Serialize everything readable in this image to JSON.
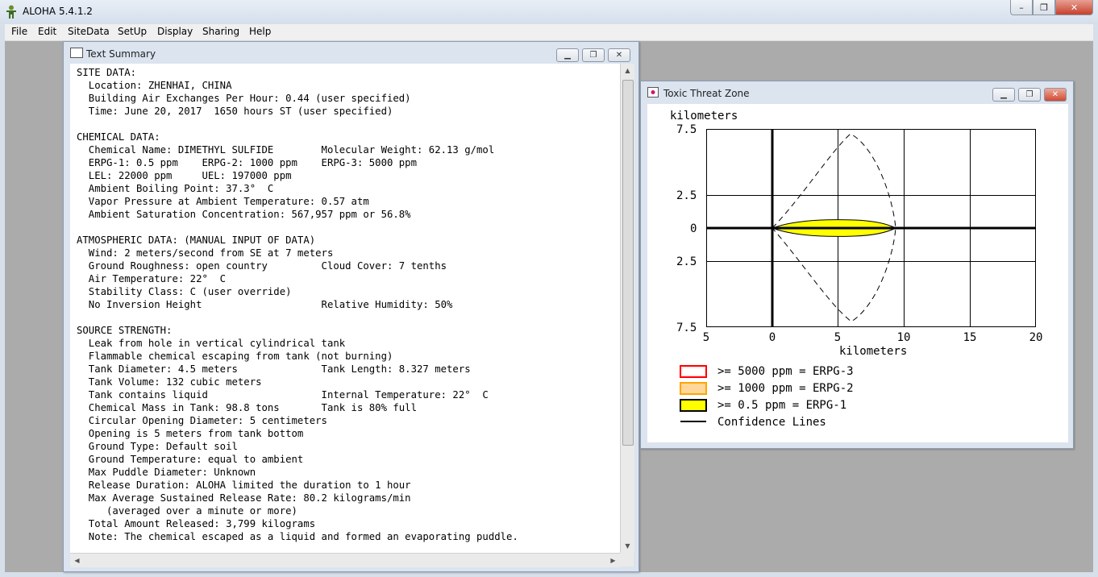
{
  "app": {
    "title": "ALOHA 5.4.1.2",
    "window_buttons": [
      "–",
      "❐",
      "✕"
    ]
  },
  "menu": [
    "File",
    "Edit",
    "SiteData",
    "SetUp",
    "Display",
    "Sharing",
    "Help"
  ],
  "text_summary": {
    "title": "Text Summary",
    "lines": [
      "SITE DATA:",
      "  Location: ZHENHAI, CHINA",
      "  Building Air Exchanges Per Hour: 0.44 (user specified)",
      "  Time: June 20, 2017  1650 hours ST (user specified)",
      "",
      "CHEMICAL DATA:",
      "  Chemical Name: DIMETHYL SULFIDE        Molecular Weight: 62.13 g/mol",
      "  ERPG-1: 0.5 ppm    ERPG-2: 1000 ppm    ERPG-3: 5000 ppm",
      "  LEL: 22000 ppm     UEL: 197000 ppm",
      "  Ambient Boiling Point: 37.3°  C",
      "  Vapor Pressure at Ambient Temperature: 0.57 atm",
      "  Ambient Saturation Concentration: 567,957 ppm or 56.8%",
      "",
      "ATMOSPHERIC DATA: (MANUAL INPUT OF DATA)",
      "  Wind: 2 meters/second from SE at 7 meters",
      "  Ground Roughness: open country         Cloud Cover: 7 tenths",
      "  Air Temperature: 22°  C",
      "  Stability Class: C (user override)",
      "  No Inversion Height                    Relative Humidity: 50%",
      "",
      "SOURCE STRENGTH:",
      "  Leak from hole in vertical cylindrical tank",
      "  Flammable chemical escaping from tank (not burning)",
      "  Tank Diameter: 4.5 meters              Tank Length: 8.327 meters",
      "  Tank Volume: 132 cubic meters",
      "  Tank contains liquid                   Internal Temperature: 22°  C",
      "  Chemical Mass in Tank: 98.8 tons       Tank is 80% full",
      "  Circular Opening Diameter: 5 centimeters",
      "  Opening is 5 meters from tank bottom",
      "  Ground Type: Default soil",
      "  Ground Temperature: equal to ambient",
      "  Max Puddle Diameter: Unknown",
      "  Release Duration: ALOHA limited the duration to 1 hour",
      "  Max Average Sustained Release Rate: 80.2 kilograms/min",
      "     (averaged over a minute or more)",
      "  Total Amount Released: 3,799 kilograms",
      "  Note: The chemical escaped as a liquid and formed an evaporating puddle."
    ]
  },
  "threat_zone": {
    "title": "Toxic Threat Zone",
    "y_unit": "kilometers",
    "x_unit": "kilometers",
    "y_ticks": [
      "7.5",
      "2.5",
      "0",
      "2.5",
      "7.5"
    ],
    "x_ticks": [
      "5",
      "0",
      "5",
      "10",
      "15",
      "20"
    ],
    "legend": [
      {
        "label": ">= 5000 ppm = ERPG-3",
        "color": "#ff0000"
      },
      {
        "label": ">= 1000 ppm = ERPG-2",
        "color": "#ffa500"
      },
      {
        "label": ">= 0.5 ppm = ERPG-1",
        "color": "#ffff00"
      },
      {
        "label": "Confidence Lines",
        "color": "#000000"
      }
    ]
  },
  "chart_data": {
    "type": "area",
    "title": "",
    "xlabel": "kilometers",
    "ylabel": "kilometers",
    "xlim": [
      -5,
      20
    ],
    "ylim": [
      -7.5,
      7.5
    ],
    "grid": true,
    "legend_placement": "bottom-left",
    "series": [
      {
        "name": ">= 0.5 ppm = ERPG-1",
        "kind": "footprint",
        "x": [
          0,
          9.4
        ],
        "half_width_max": 0.6
      },
      {
        "name": "Confidence Lines",
        "kind": "dashed-envelope",
        "x": [
          0,
          9.4
        ],
        "y_max": 7.2,
        "y_min": -7.0
      }
    ]
  }
}
